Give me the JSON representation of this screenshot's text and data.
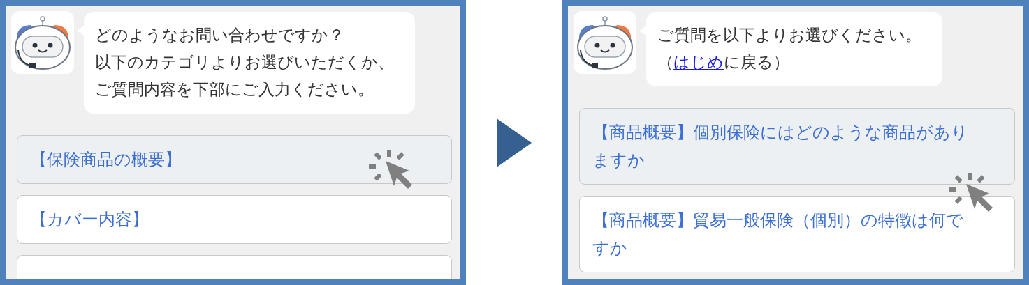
{
  "panels": [
    {
      "message": {
        "lines": [
          [
            {
              "kind": "text",
              "text": "どのようなお問い合わせですか？"
            }
          ],
          [
            {
              "kind": "text",
              "text": "以下のカテゴリよりお選びいただくか、"
            }
          ],
          [
            {
              "kind": "text",
              "text": "ご質問内容を下部にご入力ください。"
            }
          ]
        ]
      },
      "options": [
        {
          "label": "【保険商品の概要】",
          "hovered": true
        },
        {
          "label": "【カバー内容】",
          "hovered": false
        },
        {
          "hovered": false
        }
      ]
    },
    {
      "message": {
        "lines": [
          [
            {
              "kind": "text",
              "text": "ご質問を以下よりお選びください。"
            }
          ],
          [
            {
              "kind": "text",
              "text": "（"
            },
            {
              "kind": "link",
              "text": "はじめ"
            },
            {
              "kind": "text",
              "text": "に戻る）"
            }
          ]
        ]
      },
      "options": [
        {
          "label": "【商品概要】個別保険にはどのような商品がありますか",
          "hovered": true
        },
        {
          "label": "【商品概要】貿易一般保険（個別）の特徴は何ですか",
          "hovered": false
        }
      ]
    }
  ]
}
